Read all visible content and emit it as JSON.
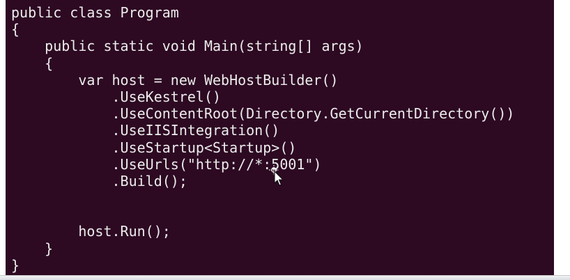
{
  "editor": {
    "background": "#2d0922",
    "text_color": "#ececec",
    "lines": [
      "public class Program",
      "{",
      "    public static void Main(string[] args)",
      "    {",
      "        var host = new WebHostBuilder()",
      "            .UseKestrel()",
      "            .UseContentRoot(Directory.GetCurrentDirectory())",
      "            .UseIISIntegration()",
      "            .UseStartup<Startup>()",
      "            .UseUrls(\"http://*:5001\")",
      "            .Build();",
      "",
      "",
      "        host.Run();",
      "    }",
      "}"
    ]
  },
  "cursor": {
    "icon": "move-pointer-icon"
  }
}
